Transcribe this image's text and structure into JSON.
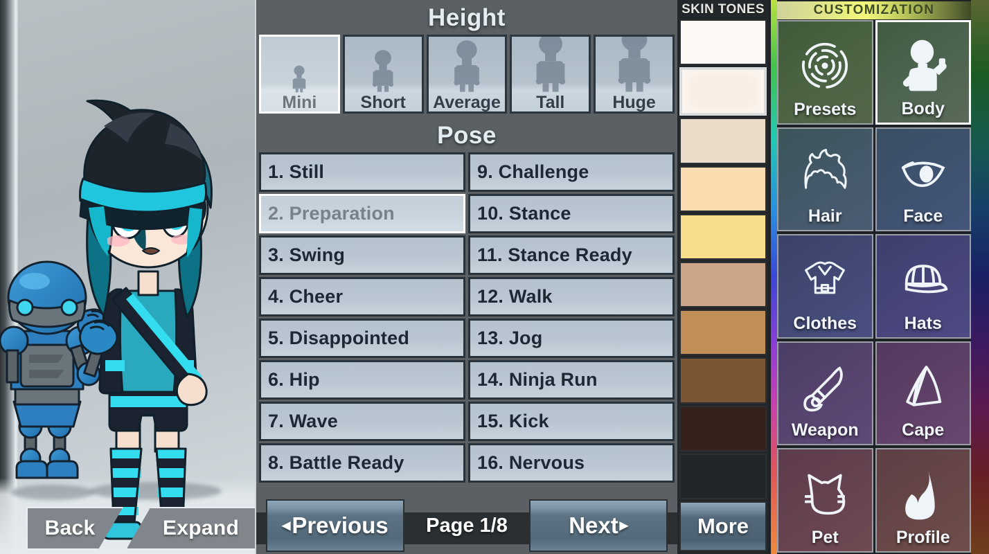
{
  "preview": {
    "back_label": "Back",
    "expand_label": "Expand"
  },
  "height": {
    "title": "Height",
    "options": [
      {
        "label": "Mini",
        "selected": true,
        "scale": 0.42
      },
      {
        "label": "Short",
        "selected": false,
        "scale": 0.66
      },
      {
        "label": "Average",
        "selected": false,
        "scale": 0.8
      },
      {
        "label": "Tall",
        "selected": false,
        "scale": 0.92
      },
      {
        "label": "Huge",
        "selected": false,
        "scale": 1.0
      }
    ]
  },
  "pose": {
    "title": "Pose",
    "options": [
      {
        "label": "1. Still",
        "selected": false
      },
      {
        "label": "9. Challenge",
        "selected": false
      },
      {
        "label": "2. Preparation",
        "selected": true
      },
      {
        "label": "10. Stance",
        "selected": false
      },
      {
        "label": "3. Swing",
        "selected": false
      },
      {
        "label": "11. Stance Ready",
        "selected": false
      },
      {
        "label": "4. Cheer",
        "selected": false
      },
      {
        "label": "12. Walk",
        "selected": false
      },
      {
        "label": "5. Disappointed",
        "selected": false
      },
      {
        "label": "13. Jog",
        "selected": false
      },
      {
        "label": "6. Hip",
        "selected": false
      },
      {
        "label": "14. Ninja Run",
        "selected": false
      },
      {
        "label": "7. Wave",
        "selected": false
      },
      {
        "label": "15. Kick",
        "selected": false
      },
      {
        "label": "8. Battle Ready",
        "selected": false
      },
      {
        "label": "16. Nervous",
        "selected": false
      }
    ]
  },
  "pager": {
    "previous_label": "Previous",
    "previous_arrow": "◂",
    "page_label": "Page 1/8",
    "page_current": 1,
    "page_total": 8,
    "next_label": "Next",
    "next_arrow": "▸"
  },
  "skin_tones": {
    "header": "SKIN TONES",
    "more_label": "More",
    "swatches": [
      {
        "color": "#fdf9f4",
        "selected": false
      },
      {
        "color": "#f9ece2",
        "selected": true
      },
      {
        "color": "#e9dcc8",
        "selected": false
      },
      {
        "color": "#fbdcb0",
        "selected": false
      },
      {
        "color": "#f8dd8d",
        "selected": false
      },
      {
        "color": "#cda68a",
        "selected": false
      },
      {
        "color": "#c28e57",
        "selected": false
      },
      {
        "color": "#7c5634",
        "selected": false
      },
      {
        "color": "#36201a",
        "selected": false
      },
      {
        "color": "#22252a",
        "selected": false
      }
    ]
  },
  "customization": {
    "header": "CUSTOMIZATION",
    "tiles": [
      {
        "label": "Presets",
        "icon": "presets-disc-icon",
        "selected": false
      },
      {
        "label": "Body",
        "icon": "body-figure-icon",
        "selected": true
      },
      {
        "label": "Hair",
        "icon": "hair-icon",
        "selected": false
      },
      {
        "label": "Face",
        "icon": "eye-icon",
        "selected": false
      },
      {
        "label": "Clothes",
        "icon": "shirt-icon",
        "selected": false
      },
      {
        "label": "Hats",
        "icon": "cap-icon",
        "selected": false
      },
      {
        "label": "Weapon",
        "icon": "sword-icon",
        "selected": false
      },
      {
        "label": "Cape",
        "icon": "cape-icon",
        "selected": false
      },
      {
        "label": "Pet",
        "icon": "cat-head-icon",
        "selected": false
      },
      {
        "label": "Profile",
        "icon": "flame-icon",
        "selected": false
      }
    ]
  }
}
